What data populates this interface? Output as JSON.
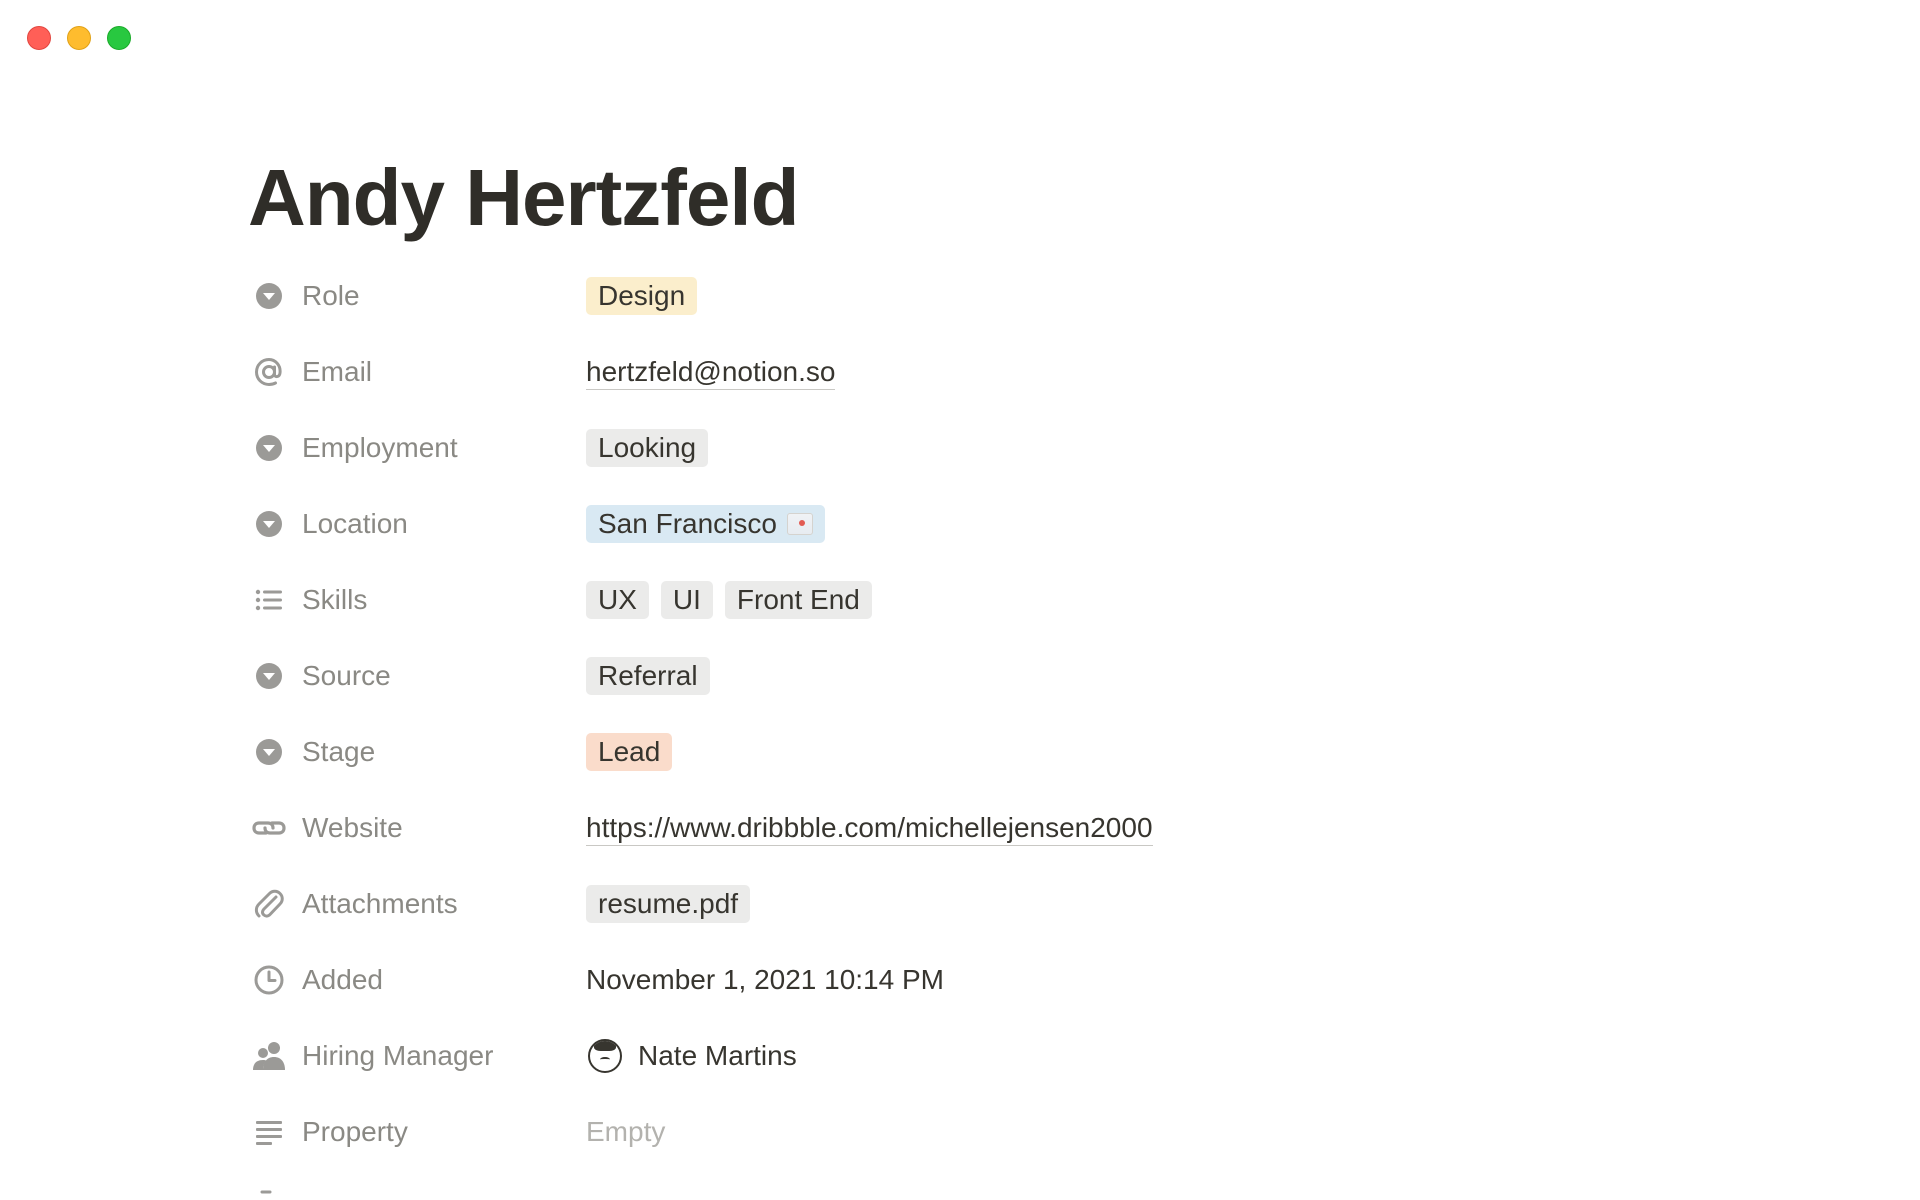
{
  "window": {
    "controls": {
      "close": "close",
      "minimize": "minimize",
      "maximize": "maximize"
    }
  },
  "page": {
    "title": "Andy Hertzfeld"
  },
  "properties": [
    {
      "key": "Role",
      "icon": "select-icon",
      "type": "select",
      "value": "Design",
      "color": "#fbeecc"
    },
    {
      "key": "Email",
      "icon": "at-icon",
      "type": "email",
      "value": "hertzfeld@notion.so"
    },
    {
      "key": "Employment",
      "icon": "select-icon",
      "type": "select",
      "value": "Looking",
      "color": "#ebebea"
    },
    {
      "key": "Location",
      "icon": "select-icon",
      "type": "select",
      "value": "San Francisco",
      "color": "#d9e9f3"
    },
    {
      "key": "Skills",
      "icon": "list-icon",
      "type": "multi_select",
      "values": [
        "UX",
        "UI",
        "Front End"
      ],
      "color": "#ebebea"
    },
    {
      "key": "Source",
      "icon": "select-icon",
      "type": "select",
      "value": "Referral",
      "color": "#ebebea"
    },
    {
      "key": "Stage",
      "icon": "select-icon",
      "type": "select",
      "value": "Lead",
      "color": "#fadccb"
    },
    {
      "key": "Website",
      "icon": "link-icon",
      "type": "url",
      "value": "https://www.dribbble.com/michellejensen2000"
    },
    {
      "key": "Attachments",
      "icon": "paperclip-icon",
      "type": "file",
      "value": "resume.pdf",
      "color": "#ebebea"
    },
    {
      "key": "Added",
      "icon": "clock-icon",
      "type": "date",
      "value": "November 1, 2021 10:14 PM"
    },
    {
      "key": "Hiring Manager",
      "icon": "person-icon",
      "type": "person",
      "value": "Nate Martins"
    },
    {
      "key": "Property",
      "icon": "text-icon",
      "type": "text",
      "value": "Empty"
    }
  ]
}
